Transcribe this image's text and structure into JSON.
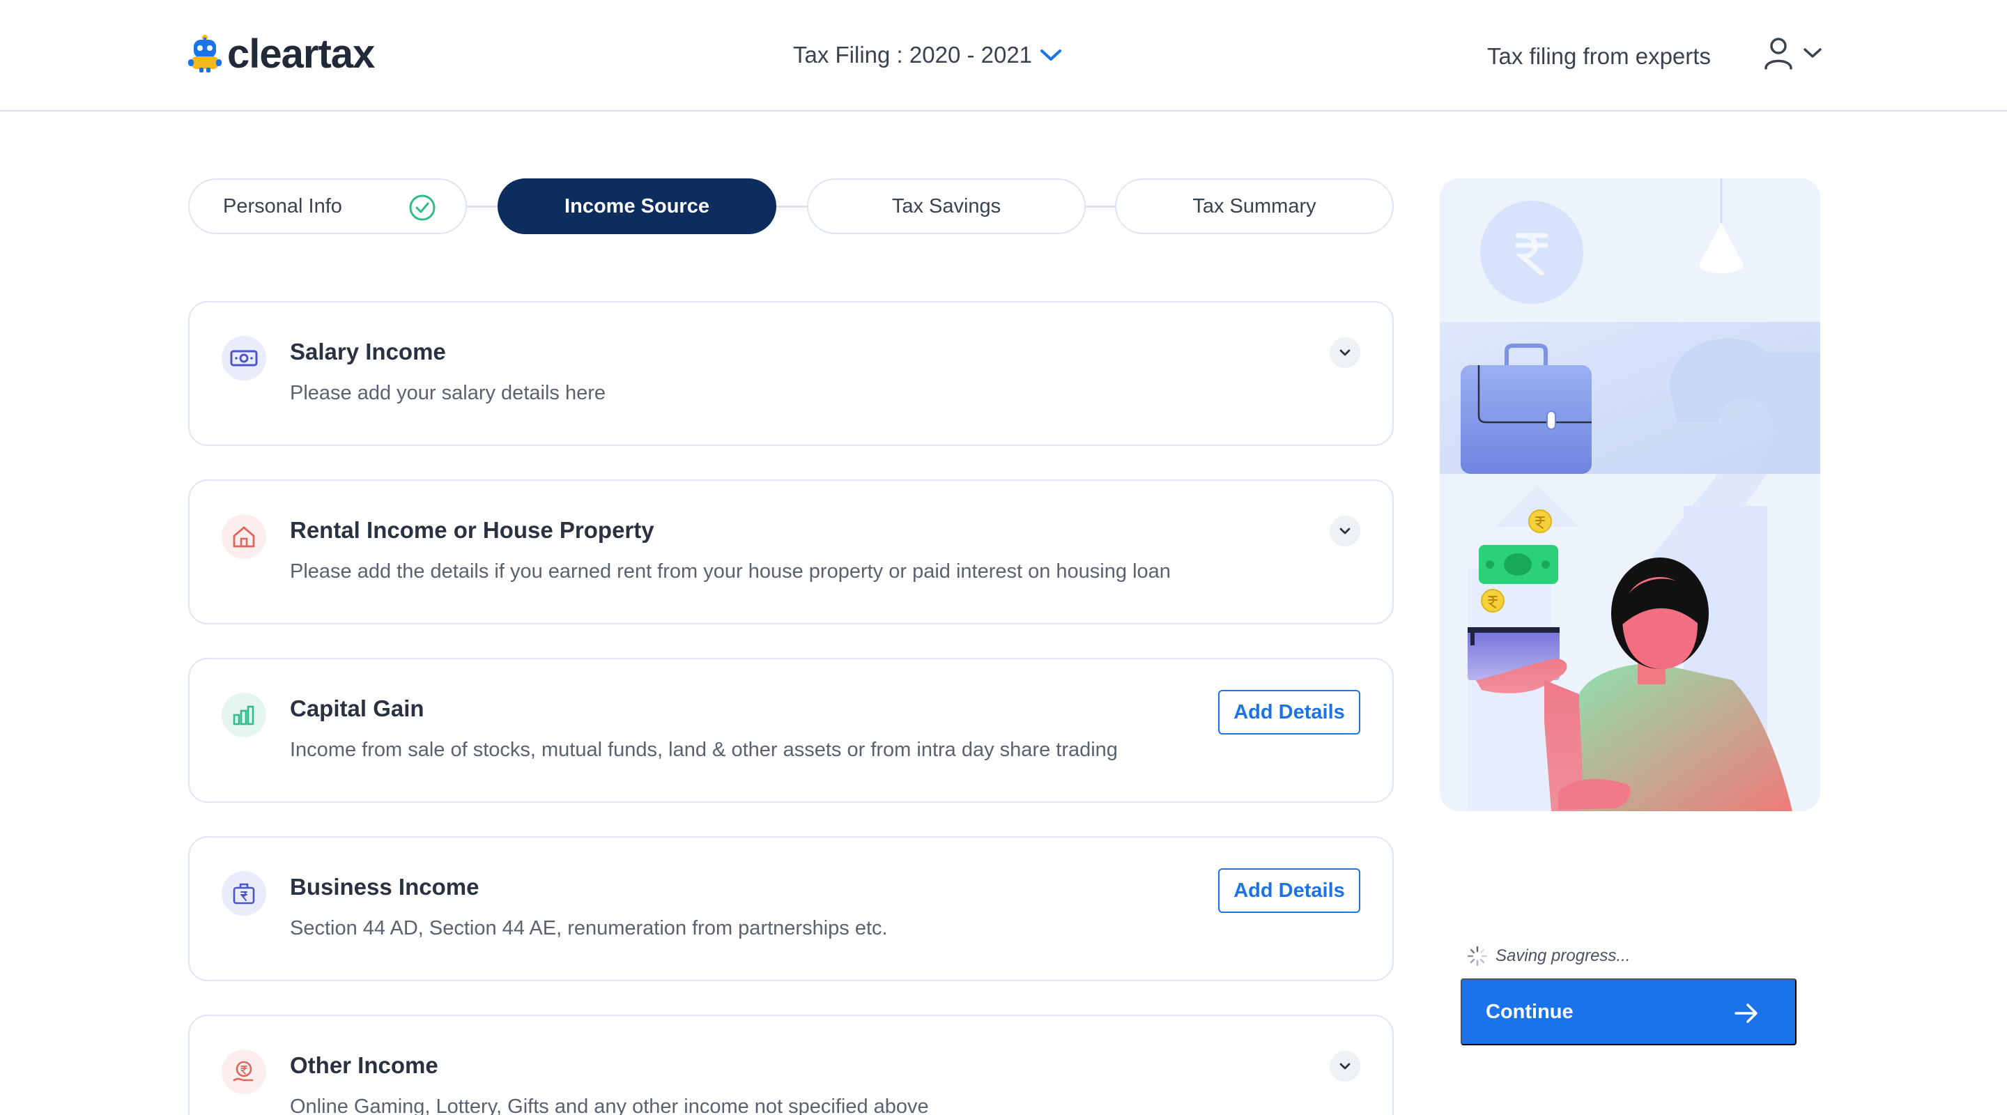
{
  "header": {
    "brand": "cleartax",
    "tax_year_label": "Tax Filing : 2020 - 2021",
    "experts_link": "Tax filing from experts"
  },
  "stepper": {
    "steps": [
      {
        "label": "Personal Info",
        "state": "completed"
      },
      {
        "label": "Income Source",
        "state": "active"
      },
      {
        "label": "Tax Savings",
        "state": "pending"
      },
      {
        "label": "Tax Summary",
        "state": "pending"
      }
    ]
  },
  "income_sources": [
    {
      "title": "Salary Income",
      "description": "Please add your salary details here",
      "action": "expand",
      "icon": "cash-icon"
    },
    {
      "title": "Rental Income or House Property",
      "description": "Please add the details if you earned rent from your house property or paid interest on housing loan",
      "action": "expand",
      "icon": "house-icon"
    },
    {
      "title": "Capital Gain",
      "description": "Income from sale of stocks, mutual funds, land & other assets or from intra day share trading",
      "action": "Add Details",
      "icon": "bar-chart-icon"
    },
    {
      "title": "Business Income",
      "description": "Section 44 AD, Section 44 AE, renumeration from partnerships etc.",
      "action": "Add Details",
      "icon": "briefcase-rupee-icon"
    },
    {
      "title": "Other Income",
      "description": "Online Gaming, Lottery, Gifts and any other income not specified above",
      "action": "expand",
      "icon": "coin-hand-icon"
    }
  ],
  "footer": {
    "saving_text": "Saving progress...",
    "continue_label": "Continue"
  },
  "colors": {
    "primary": "#1a73e8",
    "navy": "#0c2d5d",
    "success": "#2dbd8a"
  }
}
